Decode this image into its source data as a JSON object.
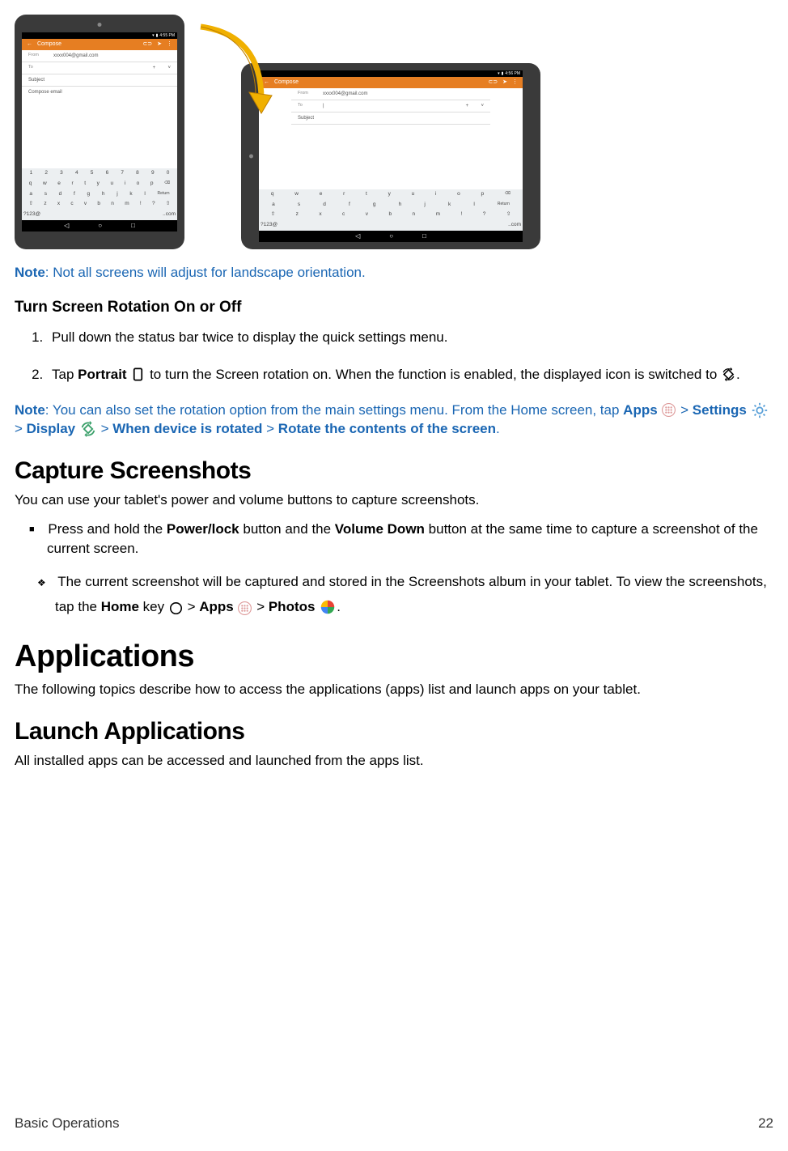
{
  "screens": {
    "statusbar_time_portrait": "4:55 PM",
    "statusbar_time_landscape": "4:56 PM",
    "appbar_title": "Compose",
    "from_label": "From",
    "from_value": "xxxx004@gmail.com",
    "to_label": "To",
    "subject_label": "Subject",
    "body_placeholder": "Compose email",
    "num_row": [
      "1",
      "2",
      "3",
      "4",
      "5",
      "6",
      "7",
      "8",
      "9",
      "0"
    ],
    "kbd_row1": [
      "q",
      "w",
      "e",
      "r",
      "t",
      "y",
      "u",
      "i",
      "o",
      "p"
    ],
    "kbd_row2": [
      "a",
      "s",
      "d",
      "f",
      "g",
      "h",
      "j",
      "k",
      "l"
    ],
    "kbd_row3": [
      "⇧",
      "z",
      "x",
      "c",
      "v",
      "b",
      "n",
      "m",
      "!",
      "?",
      "⌫"
    ],
    "kbd_row4": [
      "?123",
      "@",
      "",
      "",
      ".",
      ".com"
    ],
    "return_label": "Return"
  },
  "note1_prefix": "Note",
  "note1_text": ": Not all screens will adjust for landscape orientation.",
  "h3_rotation": "Turn Screen Rotation On or Off",
  "steps": {
    "s1": "Pull down the status bar twice to display the quick settings menu.",
    "s2a": "Tap ",
    "s2_portrait": "Portrait",
    "s2b": " to turn the Screen rotation on. When the function is enabled, the displayed icon is switched to ",
    "s2c": "."
  },
  "note2_prefix": "Note",
  "note2_a": ": You can also set the rotation option from the main settings menu. From the Home screen, tap ",
  "note2_apps": "Apps",
  "note2_settings": "Settings",
  "note2_display": "Display",
  "note2_when": "When device is rotated",
  "note2_rotate": "Rotate the contents of the screen",
  "gt": " > ",
  "period": ".",
  "h2_capture": "Capture Screenshots",
  "capture_p": "You can use your tablet's power and volume buttons to capture screenshots.",
  "bullet1a": "Press and hold the ",
  "bullet1_power": "Power/lock",
  "bullet1b": " button and the ",
  "bullet1_vol": "Volume Down",
  "bullet1c": " button at the same time to capture a screenshot of the current screen.",
  "bullet2a": "The current screenshot will be captured and stored in the Screenshots album in your tablet. To view the screenshots, tap the ",
  "bullet2_home": "Home",
  "bullet2b": " key ",
  "bullet2_apps": "Apps",
  "bullet2_photos": "Photos",
  "h1_apps": "Applications",
  "apps_p": "The following topics describe how to access the applications (apps) list and launch apps on your tablet.",
  "h2_launch": "Launch Applications",
  "launch_p": "All installed apps can be accessed and launched from the apps list.",
  "footer_left": "Basic Operations",
  "footer_right": "22"
}
